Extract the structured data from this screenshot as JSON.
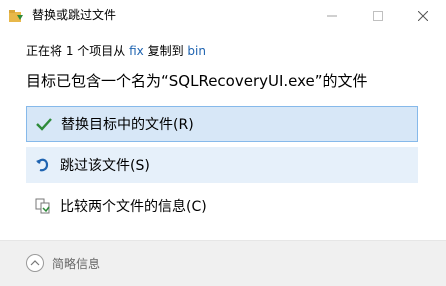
{
  "window": {
    "title": "替换或跳过文件",
    "min_icon": "minimize-icon",
    "max_icon": "maximize-icon",
    "close_icon": "close-icon"
  },
  "status": {
    "prefix": "正在将 1 个项目从 ",
    "source": "fix",
    "middle": " 复制到 ",
    "destination": "bin"
  },
  "heading": "目标已包含一个名为“SQLRecoveryUI.exe”的文件",
  "options": {
    "replace": {
      "label": "替换目标中的文件(R)",
      "icon": "checkmark-icon"
    },
    "skip": {
      "label": "跳过该文件(S)",
      "icon": "skip-arrow-icon"
    },
    "compare": {
      "label": "比较两个文件的信息(C)",
      "icon": "compare-files-icon"
    }
  },
  "footer": {
    "details_label": "简略信息",
    "details_icon": "chevron-up-icon"
  },
  "colors": {
    "link": "#1e63b0",
    "selected_bg": "#d7e7f7",
    "selected_border": "#86b9ea",
    "hover_bg": "#e6f0fa",
    "check_green": "#2e8b3a",
    "skip_blue": "#1e63b0"
  }
}
